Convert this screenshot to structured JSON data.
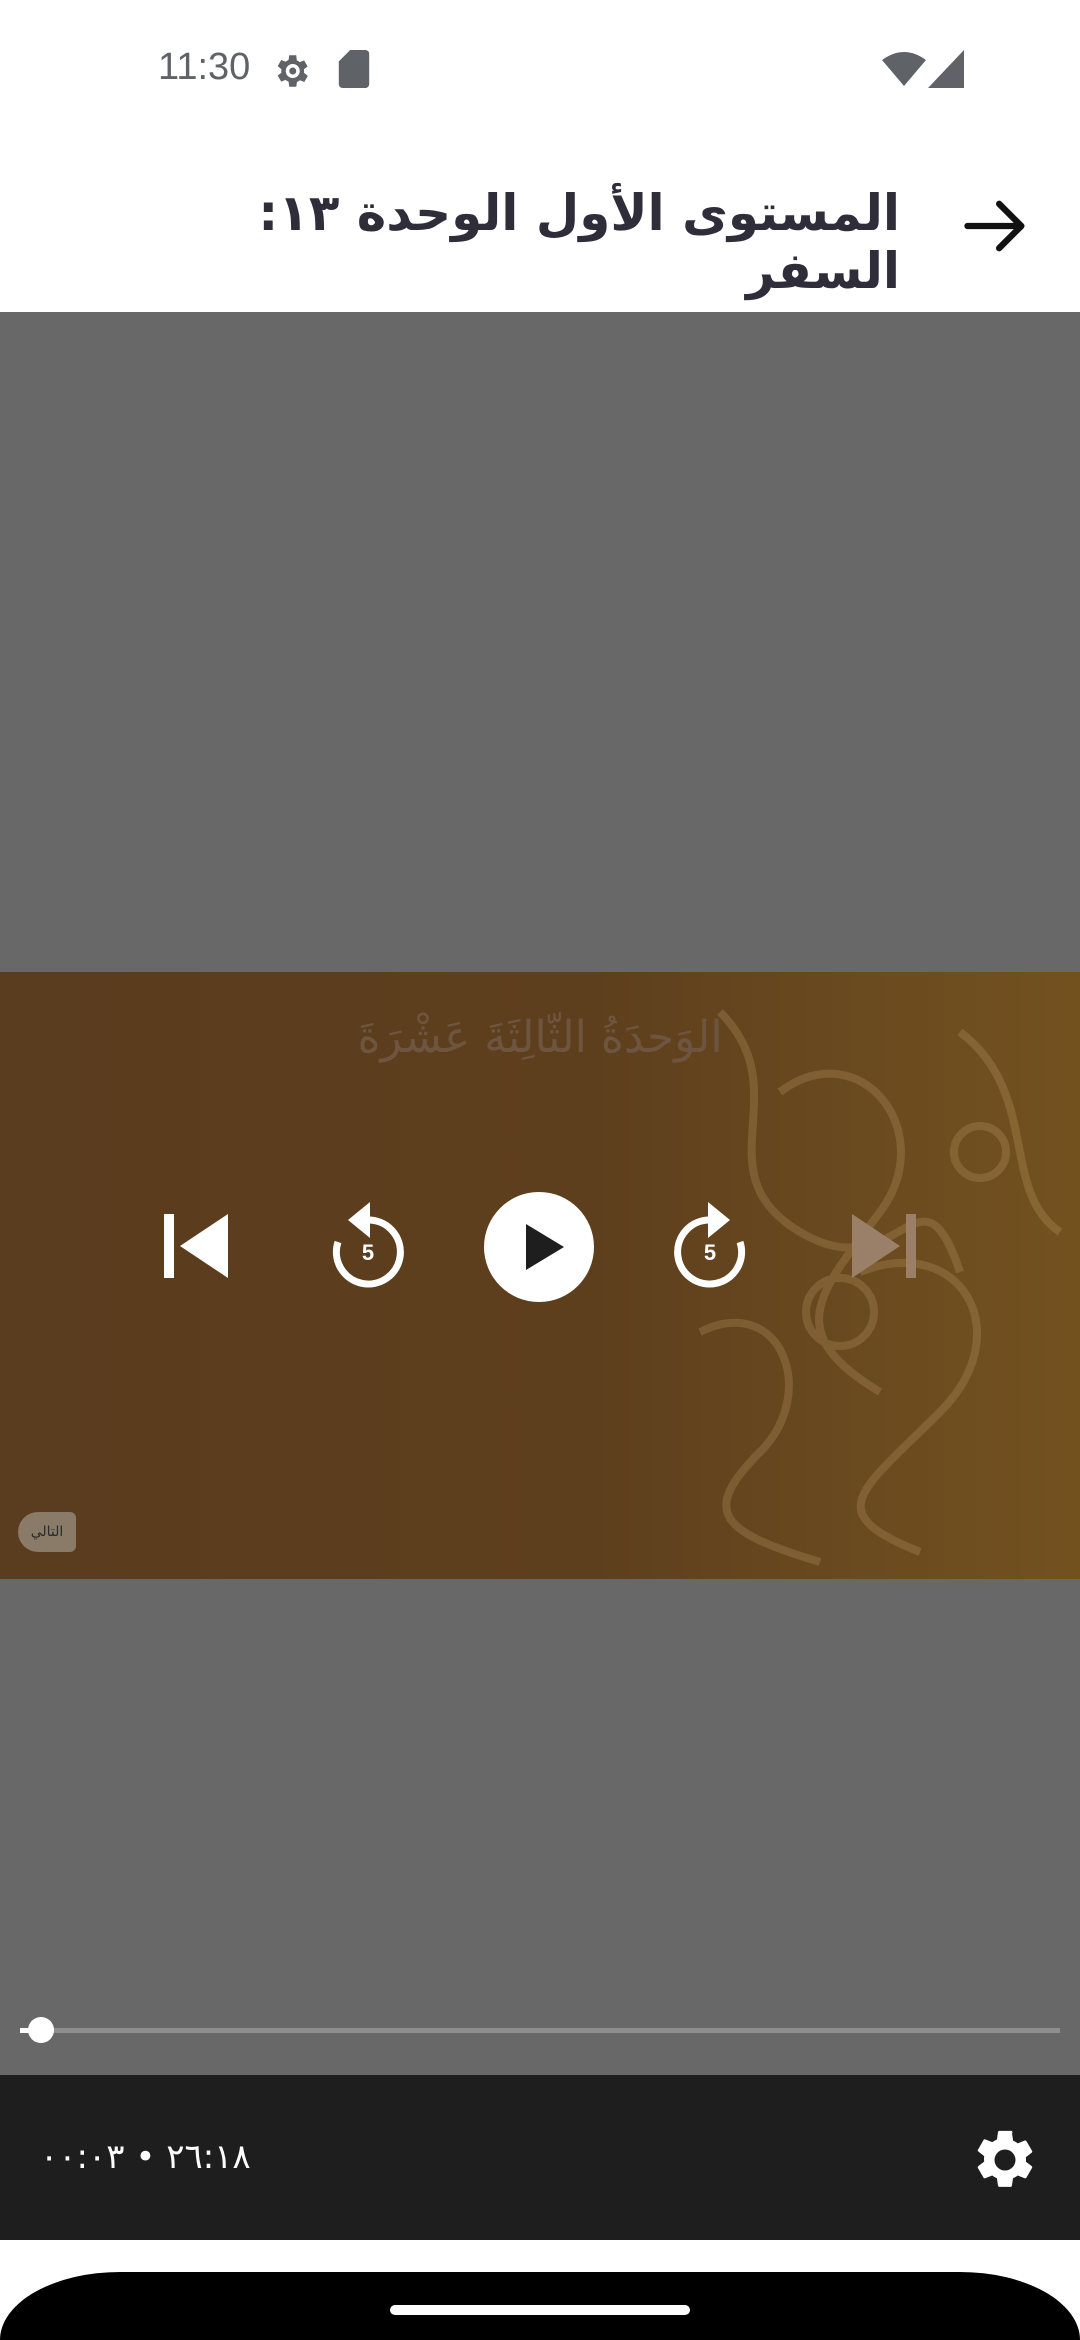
{
  "status_bar": {
    "time": "11:30",
    "icons": [
      "settings-gear-icon",
      "sd-card-icon",
      "wifi-icon",
      "cellular-signal-icon"
    ]
  },
  "header": {
    "title": "المستوى الأول الوحدة ١٣: السفر",
    "back_icon": "arrow-right-icon"
  },
  "video": {
    "frame_heading": "الوَحدَةُ الثّالِثَةَ عَشْرَةَ",
    "badge_text": "التالي",
    "controls": [
      "skip-previous-icon",
      "replay-5-icon",
      "play-icon",
      "forward-5-icon",
      "skip-next-icon"
    ],
    "rewind_seconds": "5",
    "forward_seconds": "5",
    "progress_fraction": 0.02
  },
  "bottom_bar": {
    "time_readout": "٢٦:١٨ • ٠٠:٠٣",
    "settings_icon": "gear-icon"
  },
  "colors": {
    "video_background": "#686868",
    "frame_brown": "#5d3e1e",
    "bottom_bar": "#1e1e1e",
    "title_text": "#2f2d3a"
  }
}
